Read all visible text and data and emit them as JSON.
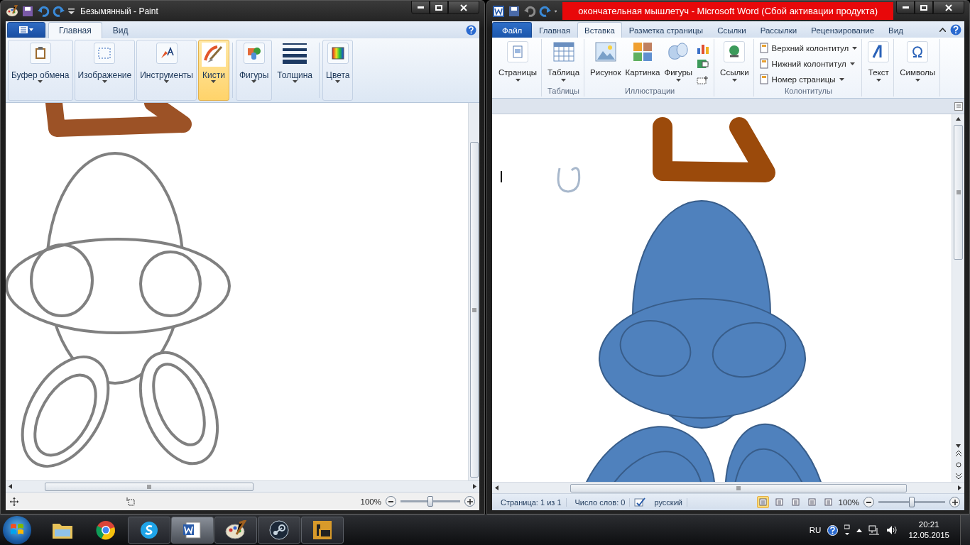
{
  "paint": {
    "title": "Безымянный - Paint",
    "tabs": [
      {
        "label": "Главная",
        "selected": true
      },
      {
        "label": "Вид",
        "selected": false
      }
    ],
    "sections": [
      [
        {
          "label": "Буфер обмена",
          "kind": "framed",
          "selected": false
        },
        {
          "label": "Изображение",
          "kind": "framed",
          "selected": false
        },
        {
          "label": "Инструменты",
          "kind": "framed",
          "selected": false
        },
        {
          "label": "Кисти",
          "kind": "framed",
          "selected": true
        }
      ],
      [
        {
          "label": "Фигуры",
          "kind": "framed",
          "selected": false
        },
        {
          "label": "Толщина",
          "kind": "plain",
          "selected": false
        }
      ],
      [
        {
          "label": "Цвета",
          "kind": "framed",
          "selected": false
        }
      ]
    ],
    "status": {
      "zoom": "100%",
      "level": 0.5
    }
  },
  "word": {
    "title": "окончательная мышлетуч - Microsoft Word (Сбой активации продукта)",
    "tabs": [
      {
        "label": "Файл",
        "kind": "file",
        "selected": false
      },
      {
        "label": "Главная",
        "kind": "tab",
        "selected": false
      },
      {
        "label": "Вставка",
        "kind": "tab",
        "selected": true
      },
      {
        "label": "Разметка страницы",
        "kind": "tab",
        "selected": false
      },
      {
        "label": "Ссылки",
        "kind": "tab",
        "selected": false
      },
      {
        "label": "Рассылки",
        "kind": "tab",
        "selected": false
      },
      {
        "label": "Рецензирование",
        "kind": "tab",
        "selected": false
      },
      {
        "label": "Вид",
        "kind": "tab",
        "selected": false
      }
    ],
    "groups": [
      {
        "items": [
          {
            "kind": "large",
            "label": "Страницы",
            "menu": true
          }
        ]
      },
      {
        "label": "Таблицы",
        "items": [
          {
            "kind": "large",
            "label": "Таблица",
            "menu": true
          }
        ]
      },
      {
        "label": "Иллюстрации",
        "items": [
          {
            "kind": "large",
            "label": "Рисунок",
            "menu": false
          },
          {
            "kind": "large",
            "label": "Картинка",
            "menu": false
          },
          {
            "kind": "large",
            "label": "Фигуры",
            "menu": true
          },
          {
            "kind": "icons"
          }
        ]
      },
      {
        "items": [
          {
            "kind": "large",
            "label": "Ссылки",
            "menu": true
          }
        ]
      },
      {
        "label": "Колонтитулы",
        "items": [
          {
            "kind": "small",
            "label": "Верхний колонтитул",
            "menu": true
          },
          {
            "kind": "small",
            "label": "Нижний колонтитул",
            "menu": true
          },
          {
            "kind": "small",
            "label": "Номер страницы",
            "menu": true
          }
        ]
      },
      {
        "items": [
          {
            "kind": "large",
            "label": "Текст",
            "menu": true
          }
        ]
      },
      {
        "items": [
          {
            "kind": "large",
            "label": "Символы",
            "menu": true
          }
        ]
      }
    ],
    "status": {
      "page": "Страница: 1 из 1",
      "words": "Число слов: 0",
      "language": "русский",
      "views": [
        {
          "selected": true
        },
        {
          "selected": false
        },
        {
          "selected": false
        },
        {
          "selected": false
        },
        {
          "selected": false
        }
      ],
      "zoom": "100%",
      "level": 0.5
    }
  },
  "taskbar": {
    "apps": [
      {
        "running": false,
        "active": false
      },
      {
        "running": false,
        "active": false
      },
      {
        "running": true,
        "active": false
      },
      {
        "running": true,
        "active": true
      },
      {
        "running": true,
        "active": false
      },
      {
        "running": true,
        "active": false
      },
      {
        "running": true,
        "active": false
      }
    ],
    "language": "RU",
    "time": "20:21",
    "date": "12.05.2015"
  }
}
